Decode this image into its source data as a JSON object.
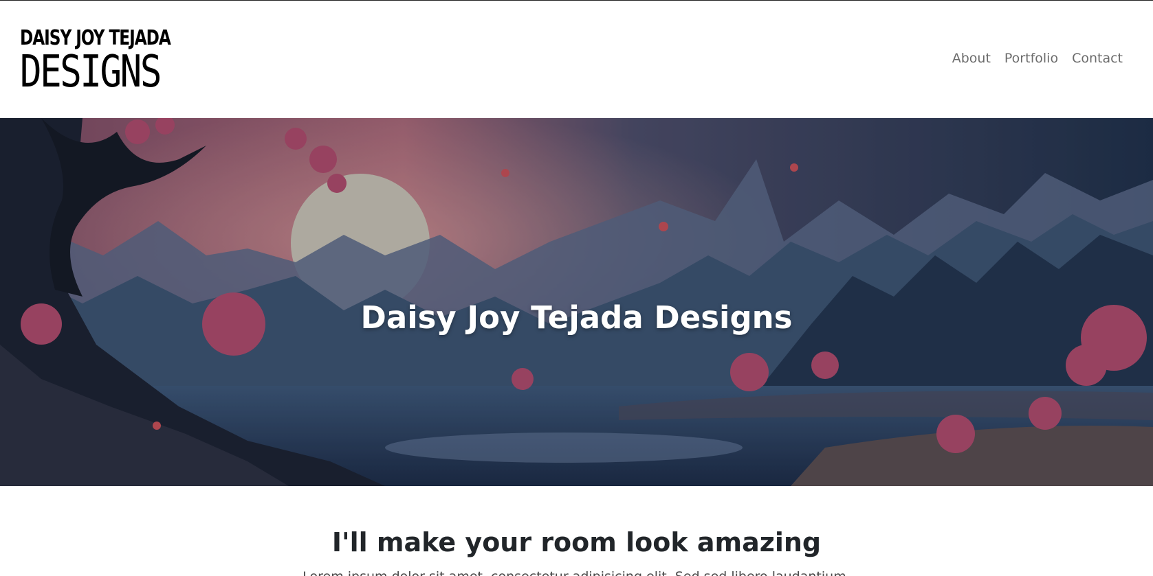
{
  "header": {
    "logo_line_1": "DAISY JOY TEJADA",
    "logo_line_2": "DESIGNS",
    "nav": {
      "about": "About",
      "portfolio": "Portfolio",
      "contact": "Contact"
    }
  },
  "hero": {
    "title": "Daisy Joy Tejada Designs",
    "image_description": "illustrated landscape with moon, mountains, lake and pink blossom trees"
  },
  "intro": {
    "heading": "I'll make your room look amazing",
    "text": "Lorem ipsum dolor sit amet, consectetur adipisicing elit. Sed sed libero laudantium."
  },
  "colors": {
    "heading_text": "#212529",
    "nav_text": "#6c6c6c",
    "hero_title": "#ffffff"
  }
}
